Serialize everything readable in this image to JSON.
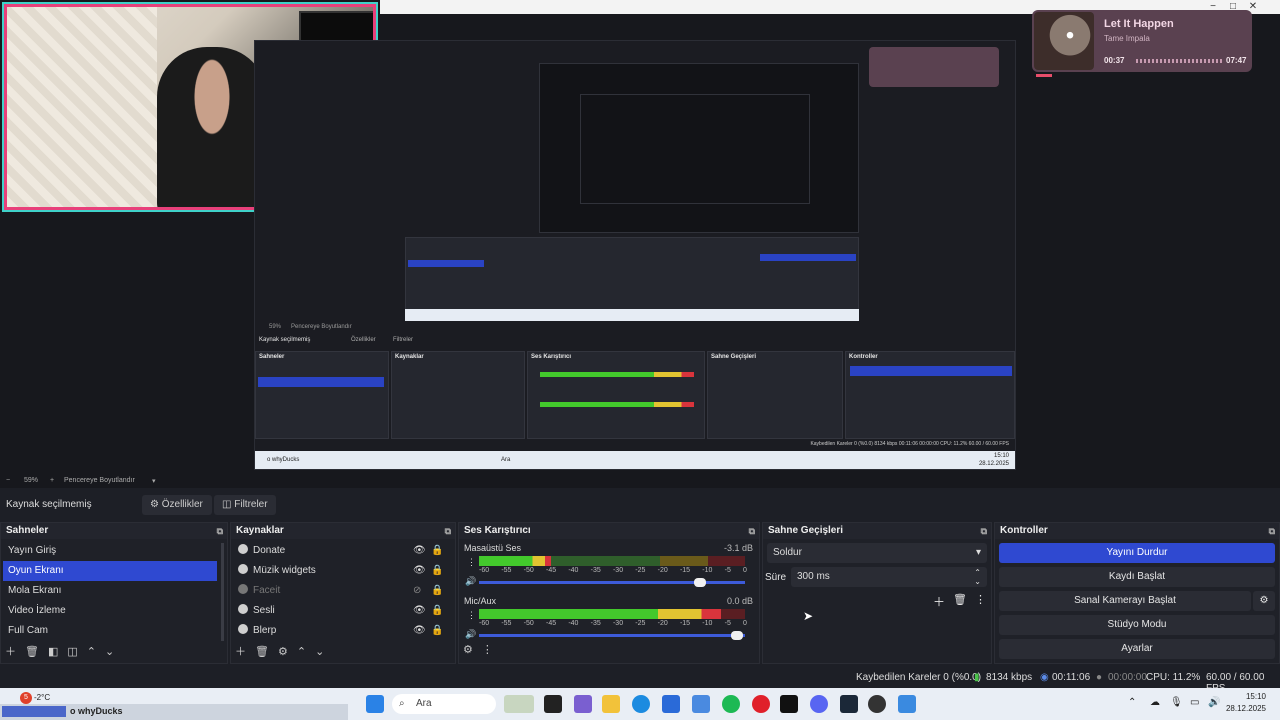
{
  "preview": {
    "nested": {
      "context_label": "Kaynak seçilmemiş",
      "properties_label": "Özellikler",
      "filters_label": "Filtreler",
      "zoom_text": "59%",
      "resize_text": "Pencereye Boyutlandır",
      "scenes_title": "Sahneler",
      "sources_title": "Kaynaklar",
      "mixer_title": "Ses Karıştırıcı",
      "transitions_title": "Sahne Geçişleri",
      "controls_title": "Kontroller",
      "stats_text": "Kaybedilen Kareler 0 (%0.0)   8134 kbps   00:11:06   00:00:00   CPU: 11.2%   60.00 / 60.00 FPS",
      "taskbar_search": "Ara",
      "taskbar_user": "o whyDucks",
      "clock_time": "15:10",
      "clock_date": "28.12.2025"
    }
  },
  "now_playing": {
    "title": "Let It Happen",
    "artist": "Tame Impala",
    "elapsed": "00:37",
    "total": "07:47",
    "progress": 0.08
  },
  "zoom": {
    "minus": "−",
    "percent": "59%",
    "plus": "+",
    "fit_label": "Pencereye Boyutlandır"
  },
  "context": {
    "label": "Kaynak seçilmemiş",
    "properties_label": "Özellikler",
    "filters_label": "Filtreler"
  },
  "scenes": {
    "title": "Sahneler",
    "items": [
      {
        "label": "Yayın Giriş",
        "active": false
      },
      {
        "label": "Oyun Ekranı",
        "active": true
      },
      {
        "label": "Mola Ekranı",
        "active": false
      },
      {
        "label": "Video İzleme",
        "active": false
      },
      {
        "label": "Full Cam",
        "active": false
      }
    ]
  },
  "sources": {
    "title": "Kaynaklar",
    "items": [
      {
        "label": "Donate",
        "visible": true
      },
      {
        "label": "Müzik widgets",
        "visible": true
      },
      {
        "label": "Faceit",
        "visible": false
      },
      {
        "label": "Sesli",
        "visible": true
      },
      {
        "label": "Blerp",
        "visible": true
      }
    ]
  },
  "mixer": {
    "title": "Ses Karıştırıcı",
    "channels": [
      {
        "name": "Masaüstü Ses",
        "db": "-3.1 dB",
        "level": 0.27,
        "fader": 0.83
      },
      {
        "name": "Mic/Aux",
        "db": "0.0 dB",
        "level": 0.91,
        "fader": 0.97
      }
    ],
    "ticks": [
      "-60",
      "-55",
      "-50",
      "-45",
      "-40",
      "-35",
      "-30",
      "-25",
      "-20",
      "-15",
      "-10",
      "-5",
      "0"
    ]
  },
  "transitions": {
    "title": "Sahne Geçişleri",
    "selected": "Soldur",
    "duration_label": "Süre",
    "duration_value": "300 ms"
  },
  "controls": {
    "title": "Kontroller",
    "stop_stream": "Yayını Durdur",
    "start_recording": "Kaydı Başlat",
    "start_virtual_cam": "Sanal Kamerayı Başlat",
    "studio_mode": "Stüdyo Modu",
    "settings": "Ayarlar"
  },
  "status": {
    "dropped_frames": "Kaybedilen Kareler 0 (%0.0)",
    "bitrate": "8134 kbps",
    "stream_time": "00:11:06",
    "record_time": "00:00:00",
    "cpu": "CPU: 11.2%",
    "fps": "60.00 / 60.00 FPS"
  },
  "taskbar": {
    "weather_temp": "-2°C",
    "weather_badge": "5",
    "user_label": "o whyDucks",
    "search_placeholder": "Ara",
    "time": "15:10",
    "date": "28.12.2025"
  },
  "colors": {
    "accent": "#2f49d1",
    "webcam_border": "#e8407a",
    "webcam_glow": "#3fd1c9"
  }
}
